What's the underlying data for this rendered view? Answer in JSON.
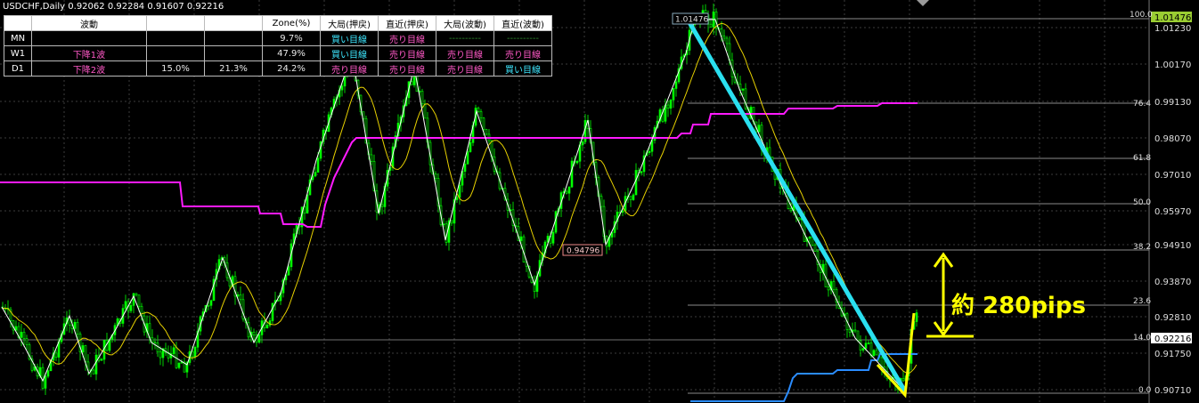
{
  "window": {
    "title": "USDCHF,Daily  0.92062 0.92284 0.91607 0.92216"
  },
  "table": {
    "headers": [
      "",
      "波動",
      "",
      "",
      "Zone(%)",
      "大局(押戻)",
      "直近(押戻)",
      "大局(波動)",
      "直近(波動)"
    ],
    "rows": [
      {
        "tf": "MN",
        "wave": "",
        "c3": "",
        "c4": "",
        "zone": "9.7%",
        "big_pull": "買い目線",
        "near_pull": "売り目線",
        "big_wave": "----------",
        "near_wave": "----------"
      },
      {
        "tf": "W1",
        "wave": "下降1波",
        "c3": "",
        "c4": "",
        "zone": "47.9%",
        "big_pull": "買い目線",
        "near_pull": "売り目線",
        "big_wave": "売り目線",
        "near_wave": "売り目線"
      },
      {
        "tf": "D1",
        "wave": "下降2波",
        "c3": "15.0%",
        "c4": "21.3%",
        "zone": "24.2%",
        "big_pull": "売り目線",
        "near_pull": "売り目線",
        "big_wave": "売り目線",
        "near_wave": "買い目線"
      }
    ]
  },
  "price_axis": [
    "1.01230",
    "1.00170",
    "0.99130",
    "0.98070",
    "0.97010",
    "0.95970",
    "0.94910",
    "0.93870",
    "0.92810",
    "0.91750",
    "0.90710"
  ],
  "current_price": "0.92216",
  "high_tag": "1.01476",
  "high_label": "1.01476",
  "low_label": "0.94796",
  "fib_levels": [
    "100.0",
    "76.4",
    "61.8",
    "50.0",
    "38.2",
    "23.6",
    "14.0",
    "0.0"
  ],
  "annotation": "約 280pips",
  "colors": {
    "background": "#000000",
    "candles": "#00ff00",
    "ma": "#e6d000",
    "magenta": "#ff1aff",
    "blue": "#2a8cff",
    "trend_cyan": "#2ae0f0",
    "arrow_yellow": "#ffff00",
    "grid": "#4a4a4a"
  },
  "icons": {
    "scroll": "chevron-down-icon"
  }
}
